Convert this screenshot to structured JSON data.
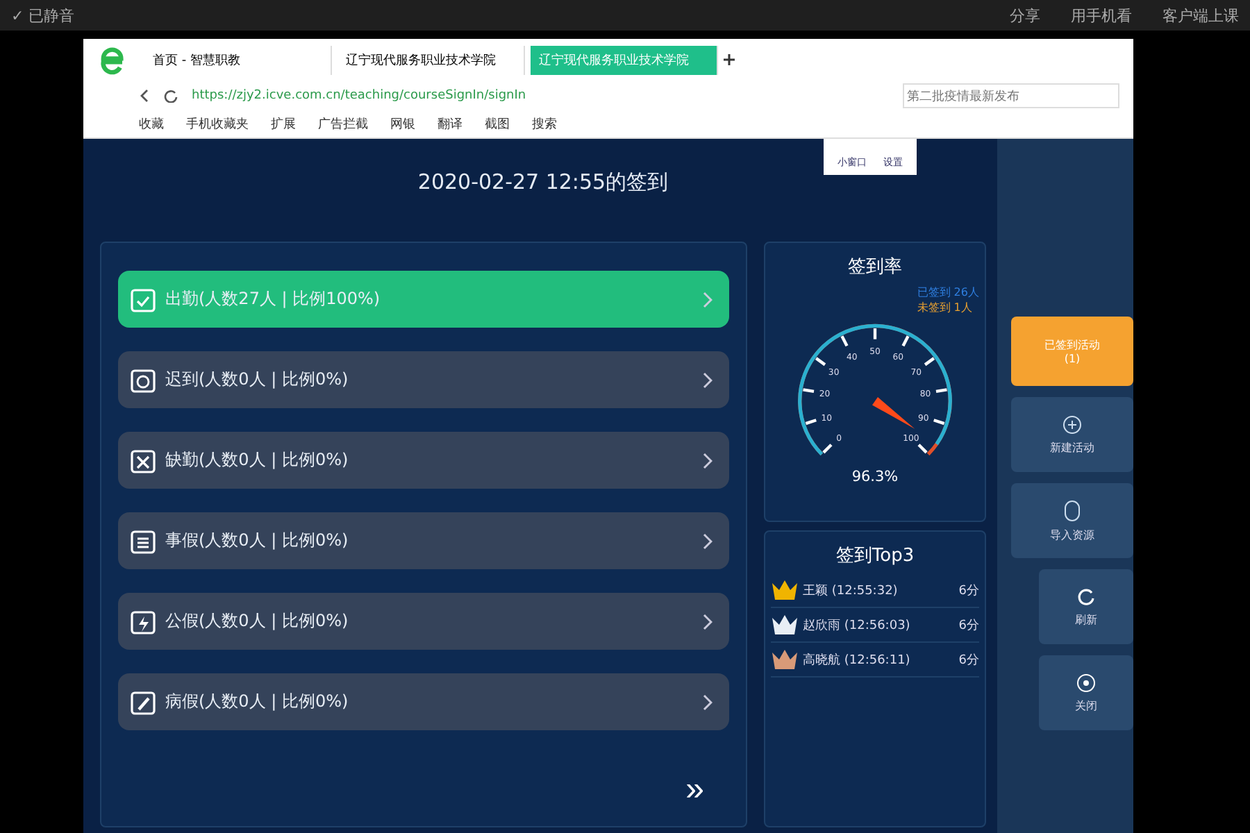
{
  "top_bar": {
    "left": "✓ 已静音",
    "actions": [
      "分享",
      "用手机看",
      "客户端上课"
    ]
  },
  "browser": {
    "tabs": [
      {
        "label": "首页 - 智慧职教",
        "selected": false
      },
      {
        "label": "辽宁现代服务职业技术学院",
        "selected": false
      },
      {
        "label": "辽宁现代服务职业技术学院",
        "selected": true
      }
    ],
    "url": "https://zjy2.icve.com.cn/teaching/courseSignIn/signIn",
    "search_placeholder": "第二批疫情最新发布",
    "bookmarks": [
      "收藏",
      "手机收藏夹",
      "扩展",
      "广告拦截",
      "网银",
      "翻译",
      "截图",
      "搜索"
    ]
  },
  "page": {
    "title": "2020-02-27 12:55的签到",
    "tools": [
      "小窗口",
      "设置"
    ],
    "status_rows": [
      {
        "kind": "present",
        "label": "出勤(人数27人 | 比例100%)",
        "selected": true
      },
      {
        "kind": "late",
        "label": "迟到(人数0人 | 比例0%)",
        "selected": false
      },
      {
        "kind": "absent",
        "label": "缺勤(人数0人 | 比例0%)",
        "selected": false
      },
      {
        "kind": "leave",
        "label": "事假(人数0人 | 比例0%)",
        "selected": false
      },
      {
        "kind": "official",
        "label": "公假(人数0人 | 比例0%)",
        "selected": false
      },
      {
        "kind": "sick",
        "label": "病假(人数0人 | 比例0%)",
        "selected": false
      }
    ],
    "more": "»",
    "rate": {
      "title": "签到率",
      "legend": [
        {
          "label": "已签到 26人",
          "color": "#2f7fe0"
        },
        {
          "label": "未签到 1人",
          "color": "#e8a030"
        }
      ],
      "ticks": [
        "0",
        "10",
        "20",
        "30",
        "40",
        "50",
        "60",
        "70",
        "80",
        "90",
        "100"
      ],
      "level": 0.963,
      "reading": "96.3%"
    },
    "top3": {
      "title": "签到Top3",
      "entries": [
        {
          "name": "王颖 (12:55:32)",
          "score": "6分",
          "color": "#f0b400"
        },
        {
          "name": "赵欣雨 (12:56:03)",
          "score": "6分",
          "color": "#e8eef5"
        },
        {
          "name": "高晓航 (12:56:11)",
          "score": "6分",
          "color": "#d89a78"
        }
      ]
    },
    "side": [
      {
        "kind": "primary",
        "label": "已签到活动\n(1)"
      },
      {
        "kind": "plus",
        "label": "新建活动"
      },
      {
        "kind": "import",
        "label": "导入资源"
      },
      {
        "kind": "refresh",
        "label": "刷新"
      },
      {
        "kind": "close",
        "label": "关闭"
      }
    ]
  }
}
